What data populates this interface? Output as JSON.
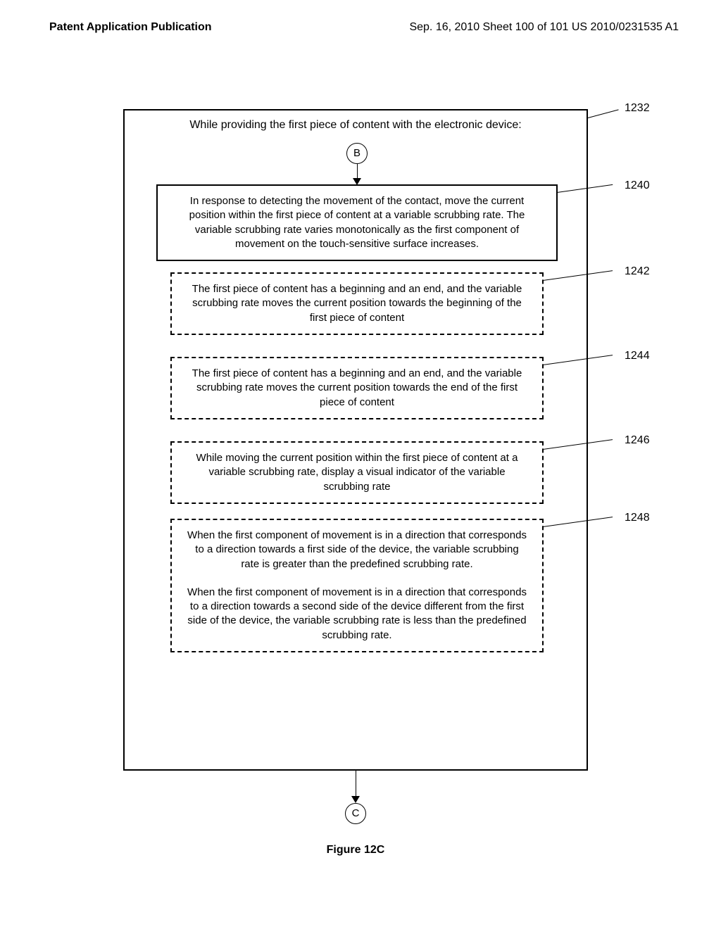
{
  "header": {
    "left": "Patent Application Publication",
    "right": "Sep. 16, 2010   Sheet 100 of 101   US 2010/0231535 A1"
  },
  "outer_heading": "While providing the first piece of content with the electronic device:",
  "connector_B": "B",
  "connector_C": "C",
  "step_1240": "In response to detecting the movement of the contact, move the current position within the first piece of content at a variable scrubbing rate.  The variable scrubbing rate varies monotonically as the first component of movement on the touch-sensitive surface increases.",
  "step_1242": "The first piece of content has a beginning and an end, and the variable scrubbing rate moves the current position towards the beginning of the first piece of content",
  "step_1244": "The first piece of content has a beginning and an end, and the variable scrubbing rate moves the current position towards the end of the first piece of content",
  "step_1246": "While moving the current position within the first piece of content at a variable scrubbing rate, display a visual indicator of the variable scrubbing rate",
  "step_1248_p1": "When the first component of movement is in a direction that corresponds to a direction towards a first side of the device, the variable scrubbing rate is greater than the predefined scrubbing rate.",
  "step_1248_p2": "When the first component of movement is in a direction that corresponds to a direction towards a second side of the device different from the first side of the device, the variable scrubbing rate is less than the predefined scrubbing rate.",
  "refs": {
    "r1232": "1232",
    "r1240": "1240",
    "r1242": "1242",
    "r1244": "1244",
    "r1246": "1246",
    "r1248": "1248"
  },
  "caption": "Figure 12C"
}
